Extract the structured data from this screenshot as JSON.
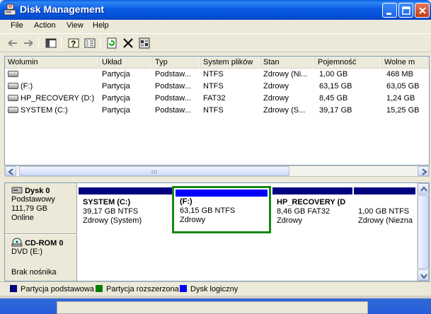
{
  "window": {
    "title": "Disk Management",
    "icon": "disk-management-app-icon",
    "buttons": [
      "minimize-icon",
      "maximize-icon",
      "close-icon"
    ]
  },
  "menu": {
    "items": [
      "File",
      "Action",
      "View",
      "Help"
    ]
  },
  "toolbar": {
    "icons": [
      "back-arrow-icon",
      "forward-arrow-icon",
      "show-hide-console-tree-icon",
      "help-icon",
      "properties-icon",
      "refresh-icon",
      "delete-icon",
      "settings-icon"
    ]
  },
  "volume_list": {
    "columns": [
      "Wolumin",
      "Układ",
      "Typ",
      "System plików",
      "Stan",
      "Pojemność",
      "Wolne m"
    ],
    "rows": [
      {
        "volume": "",
        "layout": "Partycja",
        "type": "Podstaw...",
        "fs": "NTFS",
        "status": "Zdrowy (Ni...",
        "capacity": "1,00 GB",
        "free": "468 MB"
      },
      {
        "volume": "(F:)",
        "layout": "Partycja",
        "type": "Podstaw...",
        "fs": "NTFS",
        "status": "Zdrowy",
        "capacity": "63,15 GB",
        "free": "63,05 GB"
      },
      {
        "volume": "HP_RECOVERY (D:)",
        "layout": "Partycja",
        "type": "Podstaw...",
        "fs": "FAT32",
        "status": "Zdrowy",
        "capacity": "8,45 GB",
        "free": "1,24 GB"
      },
      {
        "volume": "SYSTEM (C:)",
        "layout": "Partycja",
        "type": "Podstaw...",
        "fs": "NTFS",
        "status": "Zdrowy (S...",
        "capacity": "39,17 GB",
        "free": "15,25 GB"
      }
    ]
  },
  "disks": [
    {
      "name": "Dysk 0",
      "lines": [
        "Podstawowy",
        "111,79 GB",
        "Online"
      ],
      "partitions": [
        {
          "name": "SYSTEM  (C:)",
          "size": "39,17 GB NTFS",
          "status": "Zdrowy (System)",
          "bar": "#000080",
          "selected": false
        },
        {
          "name": "(F:)",
          "size": "63,15 GB NTFS",
          "status": "Zdrowy",
          "bar": "#0000ff",
          "selected": true
        },
        {
          "name": "HP_RECOVERY  (D",
          "size": "8,46 GB FAT32",
          "status": "Zdrowy",
          "bar": "#000080",
          "selected": false
        },
        {
          "name": "",
          "size": "1,00 GB NTFS",
          "status": "Zdrowy (Niezna",
          "bar": "#000080",
          "selected": false
        }
      ]
    },
    {
      "name": "CD-ROM 0",
      "lines": [
        "DVD (E:)",
        "",
        "Brak nośnika"
      ]
    }
  ],
  "legend": [
    {
      "label": "Partycja podstawowa",
      "color": "#000080"
    },
    {
      "label": "Partycja rozszerzona",
      "color": "#008000"
    },
    {
      "label": "Dysk logiczny",
      "color": "#0000ff"
    }
  ]
}
